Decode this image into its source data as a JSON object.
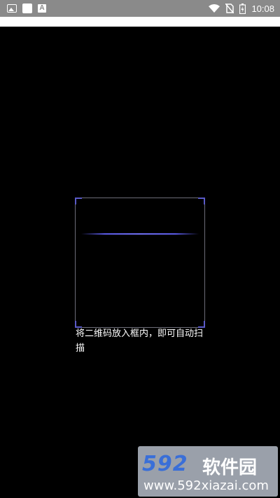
{
  "status_bar": {
    "time": "10:08",
    "left_icons": [
      "gallery-icon",
      "square-app-icon",
      "a-app-icon"
    ],
    "right_icons": [
      "wifi-icon",
      "no-sim-icon",
      "battery-icon"
    ],
    "a_icon_letter": "A"
  },
  "scanner": {
    "hint": "将二维码放入框内，即可自动扫描",
    "frame_color": "#6d6d78",
    "corner_color": "#5a5ac8",
    "scan_line_color": "#5a5ae6"
  },
  "watermark": {
    "logo": "592",
    "brand": "软件园",
    "url": "www.592xiazai.com"
  }
}
